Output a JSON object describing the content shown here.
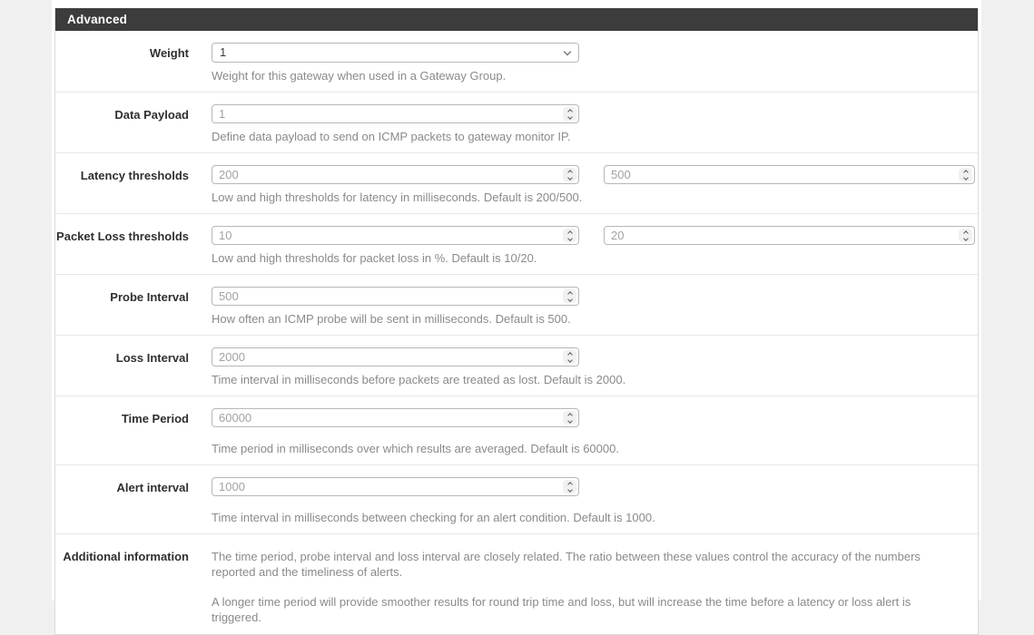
{
  "colors": {
    "page_bg": "#f0f0f0",
    "panel_header_bg": "#3c3c3c",
    "panel_header_text": "#ffffff",
    "help_text": "#8a8a8a",
    "input_border": "#b7b7bb"
  },
  "panel": {
    "title": "Advanced",
    "rows": [
      {
        "label": "Weight",
        "control": "select",
        "value": "1",
        "help": "Weight for this gateway when used in a Gateway Group."
      },
      {
        "label": "Data Payload",
        "control": "number",
        "value": "1",
        "help": "Define data payload to send on ICMP packets to gateway monitor IP."
      },
      {
        "label": "Latency thresholds",
        "control": "number-pair",
        "value": "200",
        "value2": "500",
        "help": "Low and high thresholds for latency in milliseconds. Default is 200/500."
      },
      {
        "label": "Packet Loss thresholds",
        "control": "number-pair",
        "value": "10",
        "value2": "20",
        "help": "Low and high thresholds for packet loss in %. Default is 10/20."
      },
      {
        "label": "Probe Interval",
        "control": "number",
        "value": "500",
        "help": "How often an ICMP probe will be sent in milliseconds. Default is 500."
      },
      {
        "label": "Loss Interval",
        "control": "number",
        "value": "2000",
        "help": "Time interval in milliseconds before packets are treated as lost. Default is 2000."
      },
      {
        "label": "Time Period",
        "control": "number",
        "value": "60000",
        "help": "Time period in milliseconds over which results are averaged. Default is 60000."
      },
      {
        "label": "Alert interval",
        "control": "number",
        "value": "1000",
        "help": "Time interval in milliseconds between checking for an alert condition. Default is 1000."
      },
      {
        "label": "Additional information",
        "control": "static-text",
        "paragraphs": {
          "p1": "The time period, probe interval and loss interval are closely related. The ratio between these values control the accuracy of the numbers reported and the timeliness of alerts.",
          "p2": "A longer time period will provide smoother results for round trip time and loss, but will increase the time before a latency or loss alert is triggered."
        }
      }
    ]
  }
}
